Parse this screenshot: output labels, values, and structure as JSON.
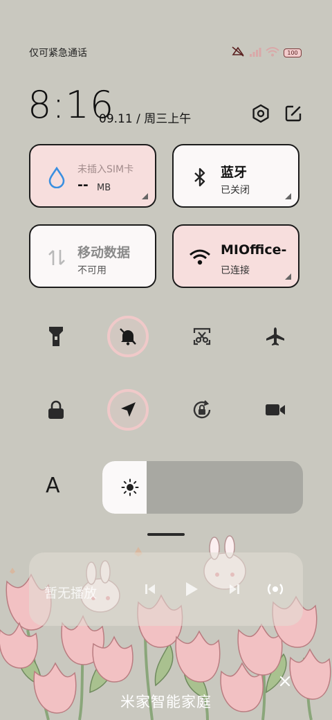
{
  "status_bar": {
    "carrier_text": "仅可紧急通话",
    "battery_level": "100",
    "icons": [
      "mute-vibrate-icon",
      "signal-icon",
      "wifi-icon",
      "battery-icon"
    ]
  },
  "header": {
    "time": "8:16",
    "date": "09.11 / 周三上午",
    "icons": [
      "settings-hex-icon",
      "edit-icon"
    ]
  },
  "tiles": [
    {
      "title": "未插入SIM卡",
      "value": "--",
      "unit": "MB",
      "icon": "water-drop-icon"
    },
    {
      "title": "蓝牙",
      "subtitle": "已关闭",
      "icon": "bluetooth-icon"
    },
    {
      "title": "移动数据",
      "subtitle": "不可用",
      "icon": "data-arrows-icon"
    },
    {
      "title": "MIOffice-",
      "subtitle": "已连接",
      "icon": "wifi-icon"
    }
  ],
  "toggles": [
    {
      "icon": "flashlight-icon",
      "active": false
    },
    {
      "icon": "mute-bell-icon",
      "active": true
    },
    {
      "icon": "screenshot-scissors-icon",
      "active": false
    },
    {
      "icon": "airplane-icon",
      "active": false
    },
    {
      "icon": "lock-icon",
      "active": false
    },
    {
      "icon": "location-arrow-icon",
      "active": true
    },
    {
      "icon": "rotation-lock-icon",
      "active": false
    },
    {
      "icon": "video-camera-icon",
      "active": false
    }
  ],
  "brightness": {
    "auto_label": "A",
    "level": 0.22,
    "icon": "sun-icon"
  },
  "media": {
    "status": "暂无播放",
    "icons": [
      "previous-icon",
      "play-icon",
      "next-icon",
      "cast-icon"
    ]
  },
  "bottom": {
    "title": "米家智能家庭",
    "icon": "close-icon"
  },
  "colors": {
    "background": "#c9c8bf",
    "tile_pink": "#f7dedd",
    "tile_white": "#fbf8f8",
    "ring_pink": "#f0c9c9",
    "wifi_blue": "#3a8fe0"
  }
}
